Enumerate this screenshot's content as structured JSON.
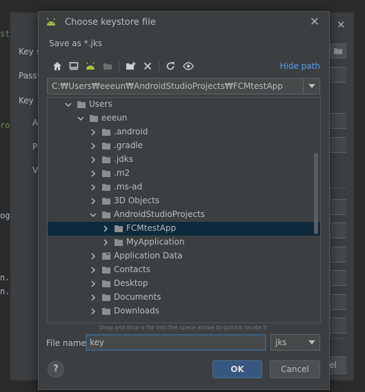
{
  "background": {
    "editor_snippets": [
      "st",
      "ro",
      "og",
      "n.",
      "n."
    ],
    "labels": [
      "Key s",
      "Passw",
      "Key",
      "A",
      "P",
      "V"
    ],
    "cancel_partial": "el"
  },
  "dialog": {
    "title": "Choose keystore file",
    "subtitle": "Save as *.jks",
    "close_glyph": "✕",
    "toolbar": {
      "icons": [
        "home-icon",
        "desktop-icon",
        "android-icon",
        "project-folder-icon",
        "new-folder-icon",
        "delete-icon",
        "refresh-icon",
        "show-hidden-icon"
      ],
      "hide_path_label": "Hide path"
    },
    "path": "C:₩Users₩eeeun₩AndroidStudioProjects₩FCMtestApp",
    "tree": [
      {
        "label": "Users",
        "expanded": true
      },
      {
        "label": "eeeun",
        "expanded": true
      },
      {
        "label": ".android",
        "expanded": false
      },
      {
        "label": ".gradle",
        "expanded": false
      },
      {
        "label": ".jdks",
        "expanded": false
      },
      {
        "label": ".m2",
        "expanded": false
      },
      {
        "label": ".ms-ad",
        "expanded": false
      },
      {
        "label": "3D Objects",
        "expanded": false
      },
      {
        "label": "AndroidStudioProjects",
        "expanded": true
      },
      {
        "label": "FCMtestApp",
        "expanded": false,
        "selected": true
      },
      {
        "label": "MyApplication",
        "expanded": false
      },
      {
        "label": "Application Data",
        "expanded": false,
        "linked": true
      },
      {
        "label": "Contacts",
        "expanded": false
      },
      {
        "label": "Desktop",
        "expanded": false
      },
      {
        "label": "Documents",
        "expanded": false
      },
      {
        "label": "Downloads",
        "expanded": false
      }
    ],
    "drop_hint": "Drag and drop a file into the space above to quickly locate it",
    "file_name_label": "File name:",
    "file_name_value": "key",
    "extension": "jks",
    "help_label": "?",
    "ok_label": "OK",
    "cancel_label": "Cancel"
  },
  "colors": {
    "dialog_bg": "#3c3f41",
    "selection": "#0d293e",
    "link": "#589df6",
    "ok_button": "#365880",
    "android_green": "#a4c639",
    "folder": "#8c8f91"
  }
}
